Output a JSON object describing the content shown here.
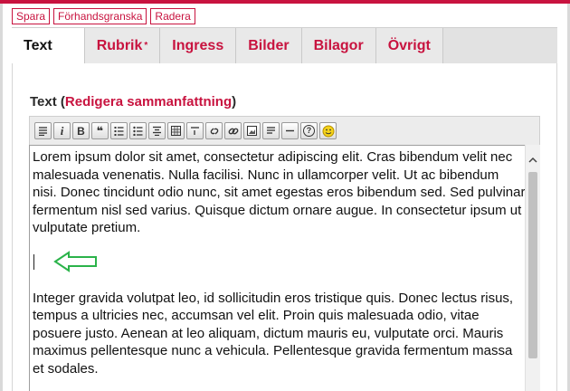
{
  "actions": {
    "save": "Spara",
    "preview": "Förhandsgranska",
    "delete": "Radera"
  },
  "tabs": [
    {
      "label": "Text",
      "active": true
    },
    {
      "label": "Rubrik",
      "required_mark": "*"
    },
    {
      "label": "Ingress"
    },
    {
      "label": "Bilder"
    },
    {
      "label": "Bilagor"
    },
    {
      "label": "Övrigt"
    }
  ],
  "field": {
    "label": "Text",
    "paren_open": " (",
    "link": "Redigera sammanfattning",
    "paren_close": ")"
  },
  "toolbar": [
    {
      "name": "format-paragraph-icon"
    },
    {
      "name": "italic-icon",
      "glyph": "i"
    },
    {
      "name": "bold-icon",
      "glyph": "B"
    },
    {
      "name": "blockquote-icon",
      "glyph": "❝"
    },
    {
      "name": "ordered-list-icon"
    },
    {
      "name": "unordered-list-icon"
    },
    {
      "name": "align-center-icon"
    },
    {
      "name": "table-icon"
    },
    {
      "name": "insert-element-icon"
    },
    {
      "name": "unlink-icon"
    },
    {
      "name": "link-icon"
    },
    {
      "name": "image-icon"
    },
    {
      "name": "align-justify-icon"
    },
    {
      "name": "horizontal-rule-icon"
    },
    {
      "name": "help-icon",
      "glyph": "?"
    },
    {
      "name": "emoticon-icon"
    }
  ],
  "editor": {
    "paragraph_1": "Lorem ipsum dolor sit amet, consectetur adipiscing elit. Cras bibendum velit nec malesuada venenatis. Nulla facilisi. Nunc in ullamcorper velit. Ut ac bibendum nisi. Donec tincidunt odio nunc, sit amet egestas eros bibendum sed. Sed pulvinar fermentum nisl sed varius. Quisque dictum ornare augue. In consectetur ipsum ut vulputate pretium.",
    "paragraph_2": "Integer gravida volutpat leo, id sollicitudin eros tristique quis. Donec lectus risus, tempus a ultricies nec, accumsan vel elit. Proin quis malesuada odio, vitae posuere justo. Aenean at leo aliquam, dictum mauris eu, vulputate orci. Mauris maximus pellentesque nunc a vehicula. Pellentesque gravida fermentum massa et sodales."
  },
  "colors": {
    "brand": "#c8133f",
    "annotation_arrow": "#2bb34a"
  }
}
